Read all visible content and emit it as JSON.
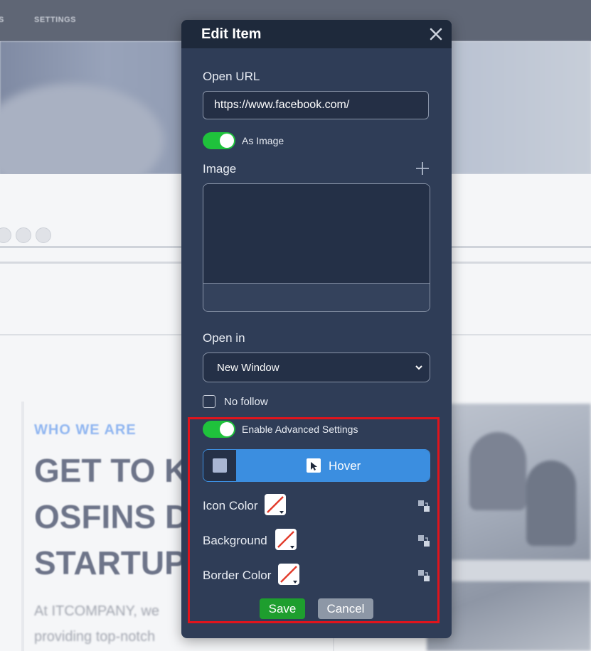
{
  "background": {
    "nav_items": [
      "S",
      "SETTINGS"
    ],
    "eyebrow": "WHO WE ARE",
    "heading_lines": [
      "GET TO KN",
      "OSFINS DI",
      "STARTUP"
    ],
    "paragraph_lines": [
      "At ITCOMPANY, we",
      "providing top-notch"
    ]
  },
  "modal": {
    "title": "Edit Item",
    "open_url_label": "Open URL",
    "open_url_value": "https://www.facebook.com/",
    "as_image_label": "As Image",
    "as_image_on": true,
    "image_label": "Image",
    "open_in_label": "Open in",
    "open_in_value": "New Window",
    "no_follow_label": "No follow",
    "no_follow_checked": false,
    "advanced_label": "Enable Advanced Settings",
    "advanced_on": true,
    "hover_label": "Hover",
    "icon_color_label": "Icon Color",
    "background_label": "Background",
    "border_color_label": "Border Color",
    "save_label": "Save",
    "cancel_label": "Cancel"
  },
  "icons": {
    "close": "close-icon",
    "add": "plus-icon",
    "chevron": "chevron-down-icon",
    "cursor": "cursor-icon",
    "reset": "reset-icon"
  },
  "colors": {
    "modal_bg": "#2f3d57",
    "header_bg": "#1e293b",
    "toggle_on": "#1fc23c",
    "hover_blue": "#3b8ee0",
    "save_green": "#1e9e2e",
    "cancel_gray": "#8d97a6",
    "highlight_red": "#e0141c"
  }
}
